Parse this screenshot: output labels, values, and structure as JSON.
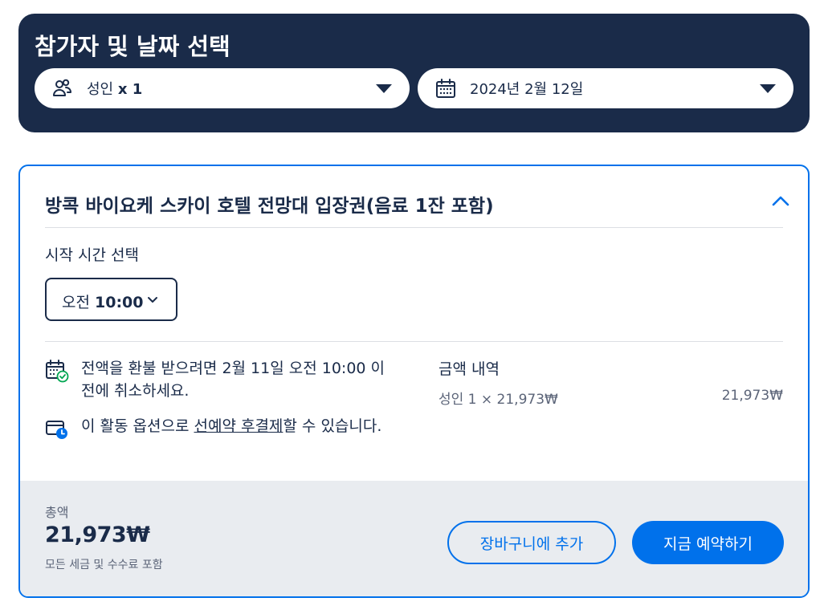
{
  "selector": {
    "title": "참가자 및 날짜 선택",
    "participants": {
      "label": "성인",
      "count": "x 1",
      "icon": "participants-icon"
    },
    "date": {
      "value": "2024년 2월 12일",
      "icon": "calendar-icon"
    }
  },
  "card": {
    "title": "방콕 바이요케 스카이 호텔 전망대 입장권(음료 1잔 포함)",
    "start_time_label": "시작 시간 선택",
    "time": {
      "period": "오전",
      "value": "10:00"
    },
    "refund_notice": "전액을 환불 받으려면 2월 11일 오전 10:00 이전에 취소하세요.",
    "reserve_notice": {
      "prefix": "이 활동 옵션으로 ",
      "link": "선예약 후결제",
      "suffix": "할 수 있습니다."
    },
    "price": {
      "title": "금액 내역",
      "line_label": "성인 1 × 21,973₩",
      "line_total": "21,973₩"
    }
  },
  "footer": {
    "total_label": "총액",
    "total_value": "21,973₩",
    "total_note": "모든 세금 및 수수료 포함",
    "cart_button": "장바구니에 추가",
    "book_button": "지금 예약하기"
  },
  "colors": {
    "navy": "#1a2b49",
    "accent": "#0071eb",
    "footer_bg": "#e9ecf0",
    "success": "#00a651"
  }
}
